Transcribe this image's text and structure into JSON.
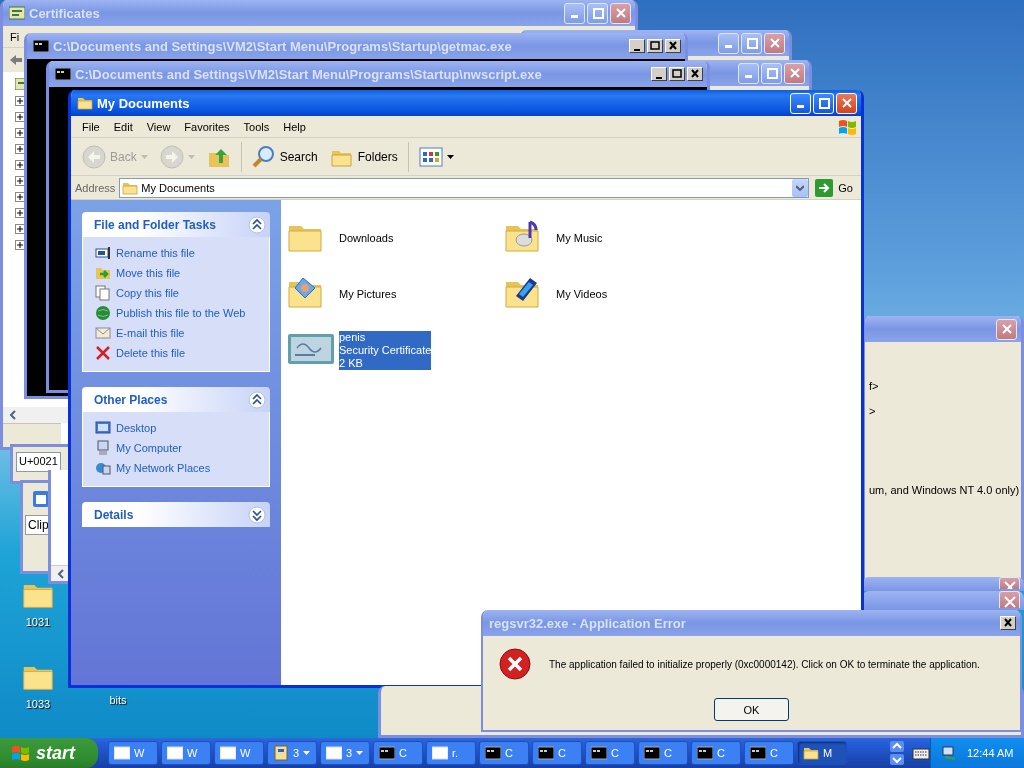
{
  "desktop_icons": [
    {
      "label": "1031",
      "kind": "folder"
    },
    {
      "label": "1033",
      "kind": "folder"
    },
    {
      "label": "bits",
      "kind": "covered"
    }
  ],
  "certificates_window": {
    "title": "Certificates",
    "active": false,
    "menu": [
      "Fi"
    ],
    "tree_nodes": [
      {
        "expanded": false
      },
      {
        "expanded": false
      },
      {
        "expanded": false
      },
      {
        "expanded": false
      },
      {
        "expanded": false
      },
      {
        "expanded": false
      },
      {
        "expanded": false
      },
      {
        "expanded": false
      },
      {
        "expanded": false
      },
      {
        "expanded": false
      }
    ]
  },
  "character_map": {
    "value": "U+0021"
  },
  "clipboard": {
    "label": "Clip"
  },
  "console_windows": [
    {
      "title": "C:\\Documents and Settings\\VM2\\Start Menu\\Programs\\Startup\\getmac.exe",
      "active": false
    },
    {
      "title": "C:\\Documents and Settings\\VM2\\Start Menu\\Programs\\Startup\\nwscript.exe",
      "active": false
    }
  ],
  "info_window": {
    "lines": [
      "f>",
      ">",
      "um, and Windows NT 4.0 only)"
    ]
  },
  "explorer": {
    "title": "My Documents",
    "active": true,
    "menu": [
      "File",
      "Edit",
      "View",
      "Favorites",
      "Tools",
      "Help"
    ],
    "toolbar": [
      {
        "label": "Back",
        "kind": "back",
        "disabled": true,
        "dropdown": true
      },
      {
        "kind": "forward",
        "disabled": true,
        "dropdown": true
      },
      {
        "kind": "up",
        "disabled": false,
        "dropdown": false
      },
      {
        "label": "Search",
        "kind": "search",
        "disabled": false,
        "dropdown": false
      },
      {
        "label": "Folders",
        "kind": "folders",
        "disabled": false,
        "dropdown": false
      },
      {
        "kind": "views",
        "disabled": false,
        "dropdown": true
      }
    ],
    "address": {
      "label": "Address",
      "value": "My Documents",
      "go": "Go"
    },
    "task_panes": [
      {
        "title": "File and Folder Tasks",
        "expanded": true,
        "items": [
          {
            "label": "Rename this file",
            "kind": "rename"
          },
          {
            "label": "Move this file",
            "kind": "move"
          },
          {
            "label": "Copy this file",
            "kind": "copy"
          },
          {
            "label": "Publish this file to the Web",
            "kind": "publish"
          },
          {
            "label": "E-mail this file",
            "kind": "email"
          },
          {
            "label": "Delete this file",
            "kind": "delete"
          }
        ]
      },
      {
        "title": "Other Places",
        "expanded": true,
        "items": [
          {
            "label": "Desktop",
            "kind": "desktop"
          },
          {
            "label": "My Computer",
            "kind": "computer"
          },
          {
            "label": "My Network Places",
            "kind": "network"
          }
        ]
      },
      {
        "title": "Details",
        "expanded": false
      }
    ],
    "items": [
      {
        "lines": [
          "Downloads"
        ],
        "kind": "folder",
        "selected": false
      },
      {
        "lines": [
          "My Music"
        ],
        "kind": "music",
        "selected": false
      },
      {
        "lines": [
          "My Pictures"
        ],
        "kind": "pictures",
        "selected": false
      },
      {
        "lines": [
          "My Videos"
        ],
        "kind": "videos",
        "selected": false
      },
      {
        "lines": [
          "penis",
          "Security Certificate",
          "2 KB"
        ],
        "kind": "certificate",
        "selected": true
      }
    ]
  },
  "error_dialog": {
    "title": "regsvr32.exe - Application Error",
    "active": false,
    "message": "The application failed to initialize properly (0xc0000142). Click on OK to terminate the application.",
    "button": "OK"
  },
  "taskbar": {
    "start": "start",
    "buttons": [
      {
        "label": "W",
        "kind": "window",
        "dropdown": false,
        "selected": false
      },
      {
        "label": "W",
        "kind": "window",
        "dropdown": false,
        "selected": false
      },
      {
        "label": "W",
        "kind": "window",
        "dropdown": false,
        "selected": false
      },
      {
        "label": "3",
        "kind": "group",
        "dropdown": true,
        "selected": false
      },
      {
        "label": "3",
        "kind": "window",
        "dropdown": true,
        "selected": false
      },
      {
        "label": "C",
        "kind": "console",
        "dropdown": false,
        "selected": false
      },
      {
        "label": "r.",
        "kind": "window",
        "dropdown": false,
        "selected": false
      },
      {
        "label": "C",
        "kind": "console",
        "dropdown": false,
        "selected": false
      },
      {
        "label": "C",
        "kind": "console",
        "dropdown": false,
        "selected": false
      },
      {
        "label": "C",
        "kind": "console",
        "dropdown": false,
        "selected": false
      },
      {
        "label": "C",
        "kind": "console",
        "dropdown": false,
        "selected": false
      },
      {
        "label": "C",
        "kind": "console",
        "dropdown": false,
        "selected": false
      },
      {
        "label": "C",
        "kind": "console",
        "dropdown": false,
        "selected": false
      },
      {
        "label": "M",
        "kind": "explorer",
        "dropdown": false,
        "selected": true
      }
    ],
    "time": "12:44 AM"
  }
}
